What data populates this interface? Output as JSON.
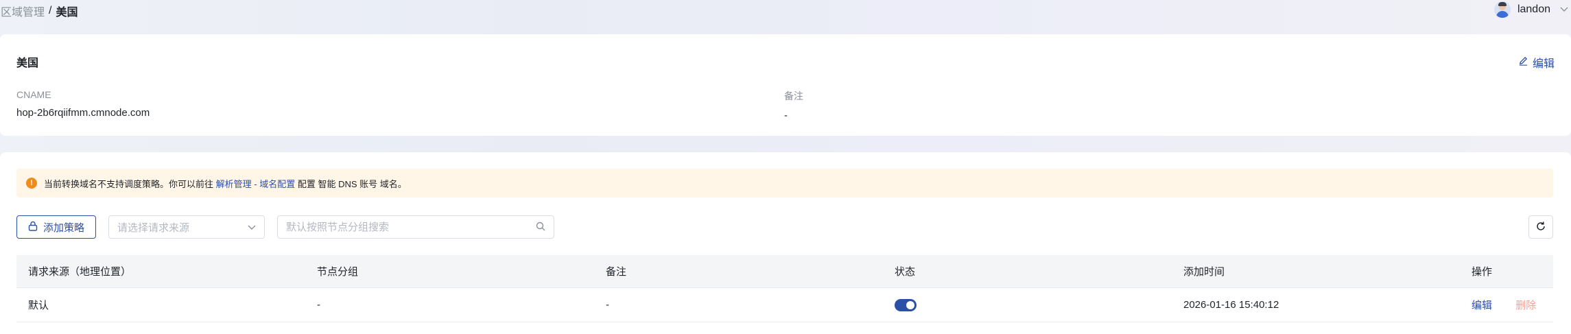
{
  "breadcrumb": {
    "parent": "区域管理",
    "separator": "/",
    "current": "美国"
  },
  "user": {
    "name": "landon"
  },
  "region": {
    "title": "美国",
    "edit_label": "编辑",
    "cname_label": "CNAME",
    "cname_value": "hop-2b6rqiifmm.cmnode.com",
    "remark_label": "备注",
    "remark_value": "-"
  },
  "alert": {
    "text_before": "当前转换域名不支持调度策略。你可以前往",
    "link1": "解析管理",
    "dash": "-",
    "link2": "域名配置",
    "text_after": "配置 智能 DNS 账号 域名。"
  },
  "toolbar": {
    "add_label": "添加策略",
    "source_placeholder": "请选择请求来源",
    "search_placeholder": "默认按照节点分组搜索"
  },
  "table": {
    "headers": [
      "请求来源（地理位置）",
      "节点分组",
      "备注",
      "状态",
      "添加时间",
      "操作"
    ],
    "rows": [
      {
        "source": "默认",
        "group": "-",
        "remark": "-",
        "status": "on",
        "time": "2026-01-16 15:40:12",
        "edit": "编辑",
        "delete": "删除"
      }
    ]
  },
  "colors": {
    "primary": "#2b50a8",
    "warning": "#f08c1a",
    "alert_bg": "#fff6e8",
    "delete": "#f2a496"
  }
}
